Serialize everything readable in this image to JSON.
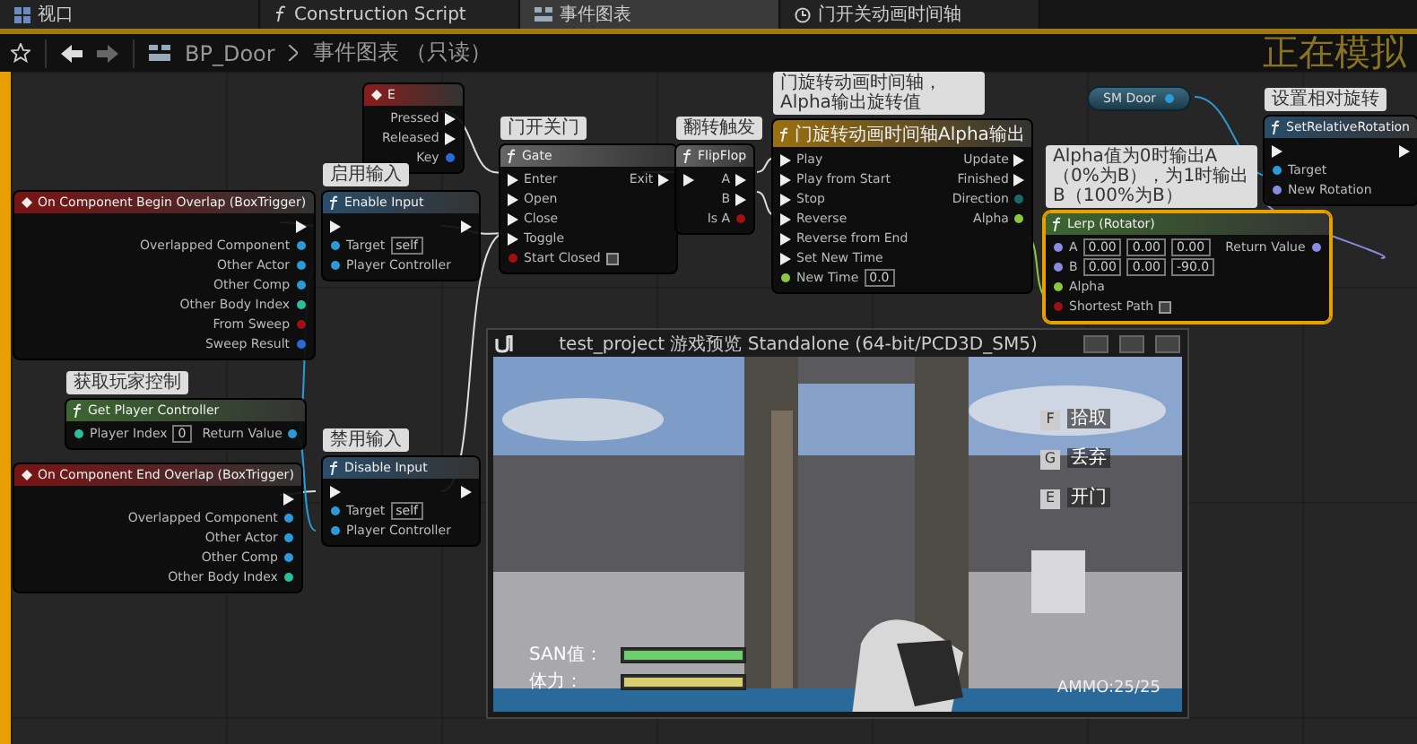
{
  "tabs": [
    {
      "label": "视口",
      "selected": false
    },
    {
      "label": "Construction Script",
      "selected": false
    },
    {
      "label": "事件图表",
      "selected": true
    },
    {
      "label": "门开关动画时间轴",
      "selected": false
    }
  ],
  "breadcrumb": {
    "blueprint": "BP_Door",
    "graph": "事件图表 （只读）"
  },
  "simulating_label": "正在模拟",
  "nodes": [
    {
      "kind": "key",
      "title": "E",
      "selected": false,
      "outputs": [
        {
          "label": "Pressed",
          "kind": "exec"
        },
        {
          "label": "Released",
          "kind": "exec"
        },
        {
          "label": "Key",
          "kind": "struct"
        }
      ]
    },
    {
      "kind": "event",
      "title": "On Component Begin Overlap (BoxTrigger)",
      "selected": false,
      "outputs": [
        {
          "kind": "exec"
        },
        {
          "label": "Overlapped Component",
          "kind": "object"
        },
        {
          "label": "Other Actor",
          "kind": "object"
        },
        {
          "label": "Other Comp",
          "kind": "object"
        },
        {
          "label": "Other Body Index",
          "kind": "int"
        },
        {
          "label": "From Sweep",
          "kind": "bool"
        },
        {
          "label": "Sweep Result",
          "kind": "struct"
        }
      ]
    },
    {
      "kind": "function",
      "title": "Enable Input",
      "comment": "启用输入",
      "selected": false,
      "inputs": [
        {
          "kind": "exec"
        },
        {
          "label": "Target",
          "kind": "object",
          "values": [
            "self"
          ]
        },
        {
          "label": "Player Controller",
          "kind": "object"
        }
      ],
      "outputs": [
        {
          "kind": "exec"
        }
      ]
    },
    {
      "kind": "pure",
      "title": "Get Player Controller",
      "comment": "获取玩家控制",
      "selected": false,
      "inputs": [
        {
          "label": "Player Index",
          "kind": "int",
          "values": [
            "0"
          ]
        }
      ],
      "outputs": [
        {
          "label": "Return Value",
          "kind": "object"
        }
      ]
    },
    {
      "kind": "event",
      "title": "On Component End Overlap (BoxTrigger)",
      "selected": false,
      "outputs": [
        {
          "kind": "exec"
        },
        {
          "label": "Overlapped Component",
          "kind": "object"
        },
        {
          "label": "Other Actor",
          "kind": "object"
        },
        {
          "label": "Other Comp",
          "kind": "object"
        },
        {
          "label": "Other Body Index",
          "kind": "int"
        }
      ]
    },
    {
      "kind": "function",
      "title": "Disable Input",
      "comment": "禁用输入",
      "selected": false,
      "inputs": [
        {
          "kind": "exec"
        },
        {
          "label": "Target",
          "kind": "object",
          "values": [
            "self"
          ]
        },
        {
          "label": "Player Controller",
          "kind": "object"
        }
      ],
      "outputs": [
        {
          "kind": "exec"
        }
      ]
    },
    {
      "kind": "macro",
      "title": "Gate",
      "comment": "门开关门",
      "selected": false,
      "inputs": [
        {
          "label": "Enter",
          "kind": "exec"
        },
        {
          "label": "Open",
          "kind": "exec"
        },
        {
          "label": "Close",
          "kind": "exec"
        },
        {
          "label": "Toggle",
          "kind": "exec"
        },
        {
          "label": "Start Closed",
          "kind": "bool",
          "checked": false
        }
      ],
      "outputs": [
        {
          "label": "Exit",
          "kind": "exec"
        }
      ]
    },
    {
      "kind": "macro",
      "title": "FlipFlop",
      "comment": "翻转触发",
      "selected": false,
      "inputs": [
        {
          "kind": "exec"
        }
      ],
      "outputs": [
        {
          "label": "A",
          "kind": "exec"
        },
        {
          "label": "B",
          "kind": "exec"
        },
        {
          "label": "Is A",
          "kind": "bool"
        }
      ]
    },
    {
      "kind": "timeline",
      "title": "门旋转动画时间轴Alpha输出",
      "comment": "门旋转动画时间轴，Alpha输出旋转值",
      "selected": false,
      "inputs": [
        {
          "label": "Play",
          "kind": "exec"
        },
        {
          "label": "Play from Start",
          "kind": "exec"
        },
        {
          "label": "Stop",
          "kind": "exec"
        },
        {
          "label": "Reverse",
          "kind": "exec"
        },
        {
          "label": "Reverse from End",
          "kind": "exec"
        },
        {
          "label": "Set New Time",
          "kind": "exec"
        },
        {
          "label": "New Time",
          "kind": "float",
          "values": [
            "0.0"
          ]
        }
      ],
      "outputs": [
        {
          "label": "Update",
          "kind": "exec"
        },
        {
          "label": "Finished",
          "kind": "exec"
        },
        {
          "label": "Direction",
          "kind": "enum"
        },
        {
          "label": "Alpha",
          "kind": "float"
        }
      ]
    },
    {
      "kind": "variable",
      "title": "SM Door",
      "selected": false,
      "outputs": [
        {
          "kind": "object"
        }
      ]
    },
    {
      "kind": "function",
      "title": "SetRelativeRotation",
      "comment": "设置相对旋转",
      "selected": false,
      "inputs": [
        {
          "kind": "exec"
        },
        {
          "label": "Target",
          "kind": "object"
        },
        {
          "label": "New Rotation",
          "kind": "rotator"
        }
      ],
      "outputs": [
        {
          "kind": "exec"
        }
      ]
    },
    {
      "kind": "pure",
      "title": "Lerp (Rotator)",
      "comment": "Alpha值为0时输出A（0%为B），为1时输出B（100%为B）",
      "selected": true,
      "inputs": [
        {
          "label": "A",
          "kind": "rotator",
          "values": [
            "0.00",
            "0.00",
            "0.00"
          ]
        },
        {
          "label": "B",
          "kind": "rotator",
          "values": [
            "0.00",
            "0.00",
            "-90.0"
          ]
        },
        {
          "label": "Alpha",
          "kind": "float"
        },
        {
          "label": "Shortest Path",
          "kind": "bool",
          "checked": false
        }
      ],
      "outputs": [
        {
          "label": "Return Value",
          "kind": "rotator"
        }
      ]
    }
  ],
  "game_window": {
    "title": "test_project 游戏预览 Standalone (64-bit/PCD3D_SM5)",
    "bars": [
      {
        "label": "SAN值：",
        "level": 1.0,
        "color": "#6fcf6f"
      },
      {
        "label": "体力：",
        "level": 1.0,
        "color": "#d8d070"
      }
    ],
    "key_hints": [
      {
        "key": "F",
        "label": "拾取"
      },
      {
        "key": "G",
        "label": "丢弃"
      },
      {
        "key": "E",
        "label": "开门"
      }
    ],
    "ammo": "AMMO:25/25"
  }
}
